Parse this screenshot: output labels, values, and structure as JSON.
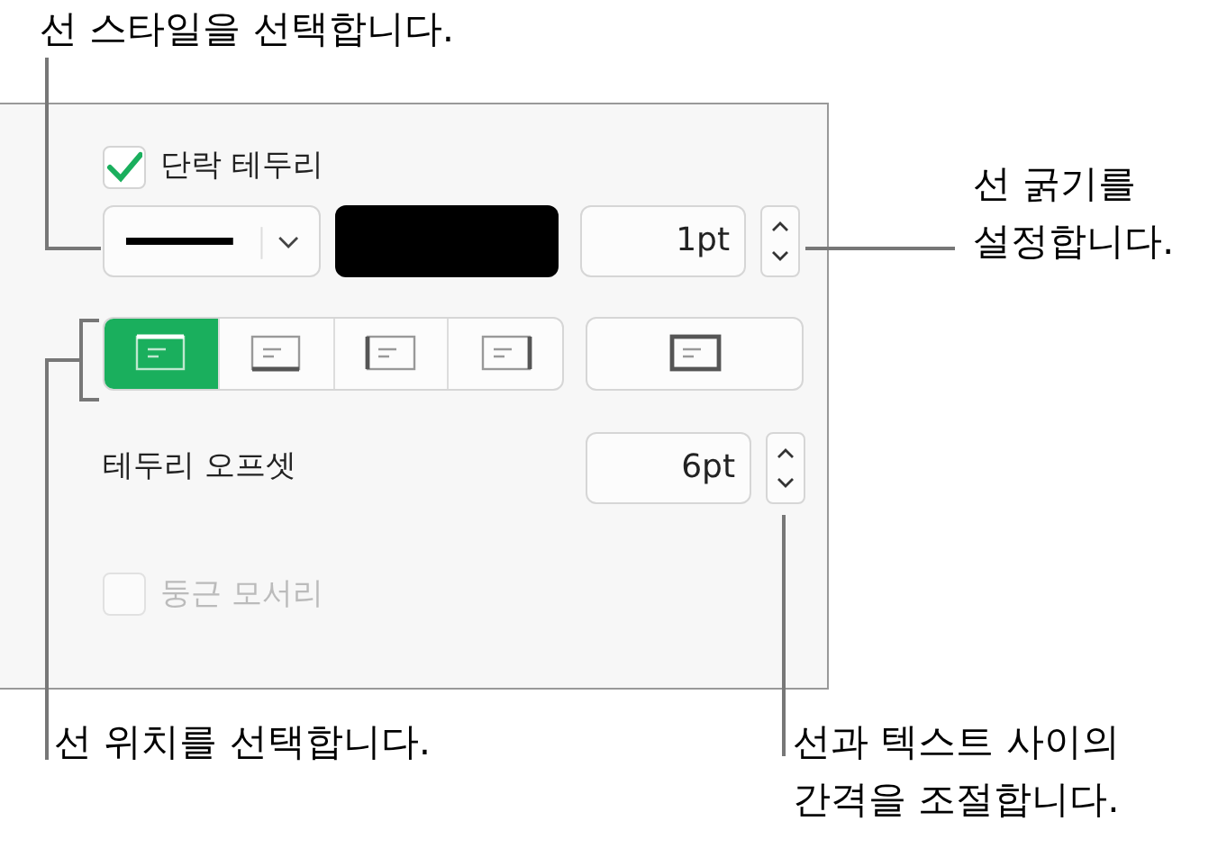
{
  "callouts": [
    {
      "lines": [
        "선 스타일을 선택합니다."
      ]
    },
    {
      "lines": [
        "선 굵기를",
        "설정합니다."
      ]
    },
    {
      "lines": [
        "선 위치를 선택합니다."
      ]
    },
    {
      "lines": [
        "선과 텍스트 사이의",
        "간격을 조절합니다."
      ]
    }
  ],
  "panel": {
    "border_checkbox": {
      "label": "단락 테두리",
      "checked": true
    },
    "stroke_width": {
      "value": "1pt"
    },
    "position_buttons": [
      {
        "kind": "top",
        "selected": true
      },
      {
        "kind": "bottom",
        "selected": false
      },
      {
        "kind": "left",
        "selected": false
      },
      {
        "kind": "right",
        "selected": false
      }
    ],
    "outline_button": {
      "kind": "box",
      "selected": false
    },
    "offset": {
      "label": "테두리 오프셋",
      "value": "6pt"
    },
    "rounded_checkbox": {
      "label": "둥근 모서리",
      "checked": false,
      "disabled": true
    }
  }
}
